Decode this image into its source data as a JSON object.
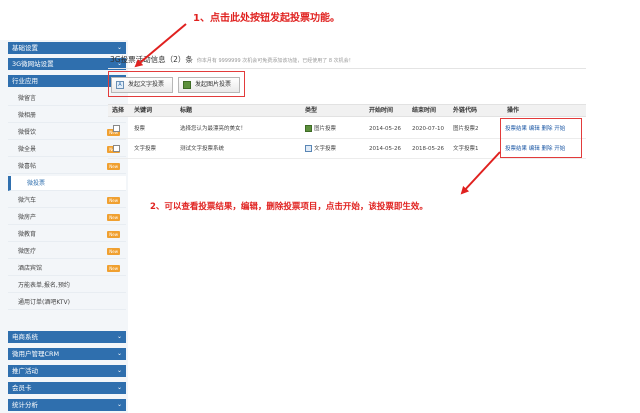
{
  "annotations": {
    "step1": "1、点击此处按钮发起投票功能。",
    "step2": "2、可以查看投票结果，编辑，删除投票项目，点击开始，该投票即生效。",
    "color": "#e0211f"
  },
  "sidebar": {
    "sections_top": [
      {
        "label": "基础设置"
      },
      {
        "label": "3G微网站设置"
      },
      {
        "label": "行业应用"
      }
    ],
    "items": [
      {
        "label": "微留言",
        "badge": ""
      },
      {
        "label": "微相册",
        "badge": ""
      },
      {
        "label": "微餐饮",
        "badge": "New"
      },
      {
        "label": "微全景",
        "badge": "New"
      },
      {
        "label": "微喜帖",
        "badge": "New"
      },
      {
        "label": "微投票",
        "badge": ""
      },
      {
        "label": "微汽车",
        "badge": "New"
      },
      {
        "label": "微房产",
        "badge": "New"
      },
      {
        "label": "微教育",
        "badge": "New"
      },
      {
        "label": "微医疗",
        "badge": "New"
      },
      {
        "label": "酒店宾馆",
        "badge": "New"
      },
      {
        "label": "万能表单,报名,预约",
        "badge": ""
      },
      {
        "label": "通用订单(酒吧KTV)",
        "badge": ""
      }
    ],
    "sections_bottom": [
      {
        "label": "电商系统"
      },
      {
        "label": "微用户管理CRM"
      },
      {
        "label": "推广活动"
      },
      {
        "label": "会员卡"
      },
      {
        "label": "统计分析"
      }
    ],
    "active_item": "微投票",
    "accent": "#2f6fae"
  },
  "main": {
    "title": "3G投票活动信息（2）条",
    "subtitle": "你本月有 9999999 次机会可免费添加该功能，已经使用了 8 次机会！",
    "buttons": {
      "text_vote": "发起文字投票",
      "image_vote": "发起图片投票"
    },
    "table": {
      "headers": [
        "选择",
        "关键词",
        "标题",
        "类型",
        "开始时间",
        "结束时间",
        "外链代码",
        "操作"
      ],
      "rows": [
        {
          "keyword": "投票",
          "title": "选择您认为最漂亮的美女！",
          "type": "图片投票",
          "start": "2014-05-26",
          "end": "2020-07-10",
          "code": "图片投票2",
          "ops": [
            "投票结果",
            "编辑",
            "删除",
            "开始"
          ]
        },
        {
          "keyword": "文字投票",
          "title": "测试文字投票系统",
          "type": "文字投票",
          "start": "2014-05-26",
          "end": "2018-05-26",
          "code": "文字投票1",
          "ops": [
            "投票结果",
            "编辑",
            "删除",
            "开始"
          ]
        }
      ]
    }
  }
}
